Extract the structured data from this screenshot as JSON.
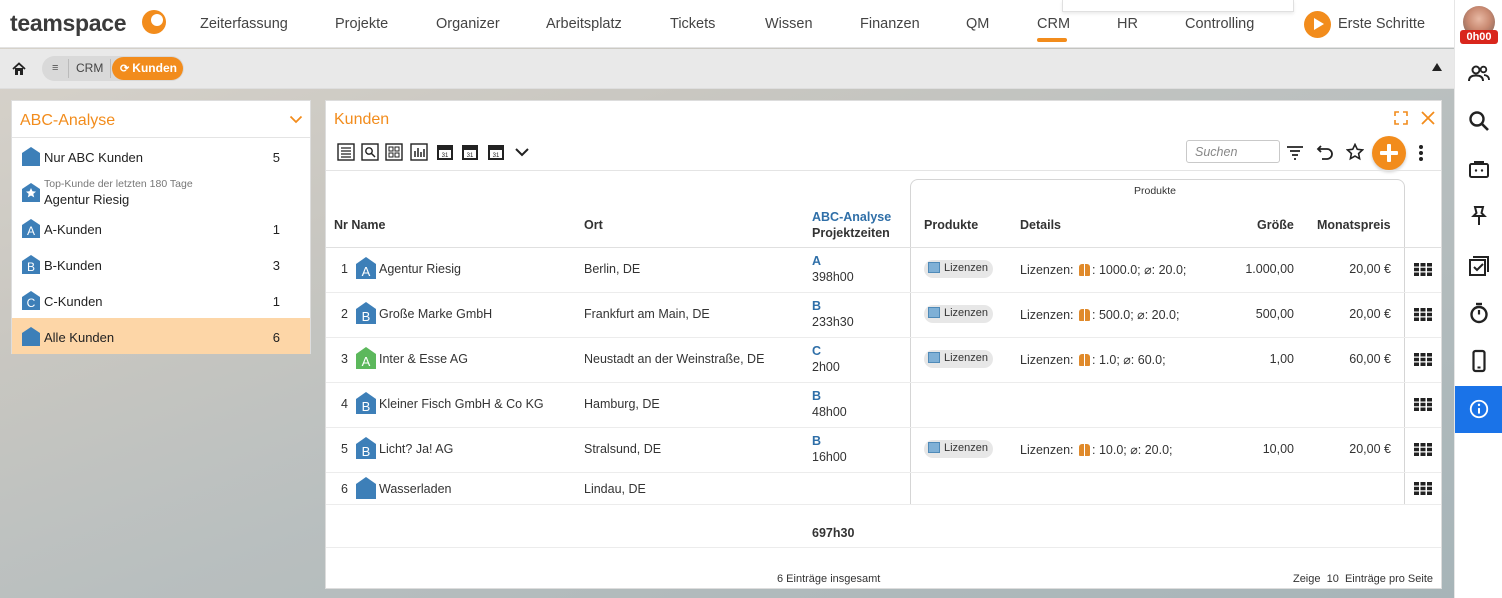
{
  "app": {
    "logo_text": "teamspace"
  },
  "nav": {
    "items": [
      "Zeiterfassung",
      "Projekte",
      "Organizer",
      "Arbeitsplatz",
      "Tickets",
      "Wissen",
      "Finanzen",
      "QM",
      "CRM",
      "HR",
      "Controlling"
    ],
    "active": "CRM",
    "erste_schritte": "Erste Schritte"
  },
  "user": {
    "timer": "0h00"
  },
  "breadcrumb": {
    "list_icon": "≡",
    "crm": "CRM",
    "active": "Kunden",
    "active_icon": "refresh-icon"
  },
  "left_panel": {
    "title": "ABC-Analyse",
    "items": [
      {
        "label": "Nur ABC Kunden",
        "count": "5",
        "icon": "house-icon"
      },
      {
        "sub": "Top-Kunde der letzten 180 Tage",
        "label": "Agentur Riesig",
        "icon": "star-house-icon"
      },
      {
        "label": "A-Kunden",
        "count": "1",
        "letter": "A"
      },
      {
        "label": "B-Kunden",
        "count": "3",
        "letter": "B"
      },
      {
        "label": "C-Kunden",
        "count": "1",
        "letter": "C"
      },
      {
        "label": "Alle Kunden",
        "count": "6",
        "icon": "house-icon",
        "active": true
      }
    ]
  },
  "main": {
    "title": "Kunden",
    "search_placeholder": "Suchen",
    "group_label": "Produkte",
    "columns": {
      "nr_name": "Nr Name",
      "ort": "Ort",
      "abc": "ABC-Analyse",
      "projektzeiten": "Projektzeiten",
      "produkte": "Produkte",
      "details": "Details",
      "groesse": "Größe",
      "monatspreis": "Monatspreis"
    },
    "rows": [
      {
        "nr": "1",
        "letter": "A",
        "color": "#3d7fb8",
        "name": "Agentur Riesig",
        "ort": "Berlin, DE",
        "abc": "A",
        "zeit": "398h00",
        "produkt": "Lizenzen",
        "det_pre": "Lizenzen:",
        "det_post": ": 1000.0; ⌀: 20.0;",
        "groesse": "1.000,00",
        "preis": "20,00 €"
      },
      {
        "nr": "2",
        "letter": "B",
        "color": "#3d7fb8",
        "name": "Große Marke GmbH",
        "ort": "Frankfurt am Main, DE",
        "abc": "B",
        "zeit": "233h30",
        "produkt": "Lizenzen",
        "det_pre": "Lizenzen:",
        "det_post": ": 500.0; ⌀: 20.0;",
        "groesse": "500,00",
        "preis": "20,00 €"
      },
      {
        "nr": "3",
        "letter": "A",
        "color": "#5cb85c",
        "name": "Inter & Esse AG",
        "ort": "Neustadt an der Weinstraße, DE",
        "abc": "C",
        "zeit": "2h00",
        "produkt": "Lizenzen",
        "det_pre": "Lizenzen:",
        "det_post": ": 1.0; ⌀: 60.0;",
        "groesse": "1,00",
        "preis": "60,00 €"
      },
      {
        "nr": "4",
        "letter": "B",
        "color": "#3d7fb8",
        "name": "Kleiner Fisch GmbH & Co KG",
        "ort": "Hamburg, DE",
        "abc": "B",
        "zeit": "48h00"
      },
      {
        "nr": "5",
        "letter": "B",
        "color": "#3d7fb8",
        "name": "Licht? Ja! AG",
        "ort": "Stralsund, DE",
        "abc": "B",
        "zeit": "16h00",
        "produkt": "Lizenzen",
        "det_pre": "Lizenzen:",
        "det_post": ": 10.0; ⌀: 20.0;",
        "groesse": "10,00",
        "preis": "20,00 €"
      },
      {
        "nr": "6",
        "letter": "",
        "color": "#3d7fb8",
        "name": "Wasserladen",
        "ort": "Lindau, DE"
      }
    ],
    "sum_zeit": "697h30",
    "footer_total": "6 Einträge insgesamt",
    "footer_pager": "Zeige  10  Einträge pro Seite"
  },
  "colors": {
    "accent": "#f28c1c",
    "abc_blue": "#2f6fa8",
    "info_blue": "#1a73e8",
    "timer_red": "#d9261c"
  }
}
